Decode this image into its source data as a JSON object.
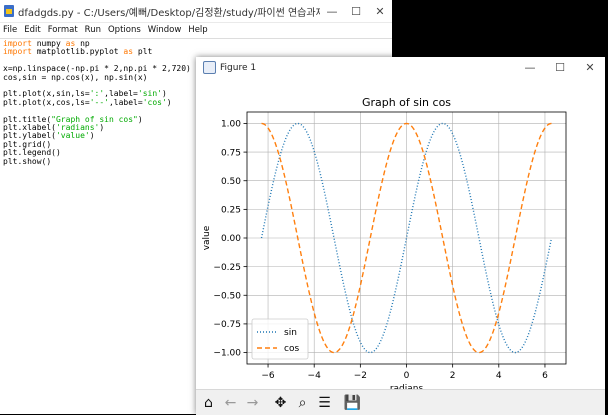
{
  "editor": {
    "title": "dfadgds.py - C:/Users/예뻐/Desktop/김정환/study/파이썬 연습과제/dfadgds.py ...",
    "menu": [
      "File",
      "Edit",
      "Format",
      "Run",
      "Options",
      "Window",
      "Help"
    ],
    "code": {
      "l1": {
        "kw1": "import",
        "mod1": " numpy ",
        "kw2": "as",
        "mod2": " np"
      },
      "l2": {
        "kw1": "import",
        "mod1": " matplotlib.pyplot ",
        "kw2": "as",
        "mod2": " plt"
      },
      "l4": "x=np.linspace(-np.pi * 2,np.pi * 2,720)",
      "l5": "cos,sin = np.cos(x), np.sin(x)",
      "l7": {
        "a": "plt.plot(x,sin,ls=",
        "s1": "':'",
        "b": ",label=",
        "s2": "'sin'",
        "c": ")"
      },
      "l8": {
        "a": "plt.plot(x,cos,ls=",
        "s1": "'--'",
        "b": ",label=",
        "s2": "'cos'",
        "c": ")"
      },
      "l10": {
        "a": "plt.title(",
        "s1": "\"Graph of sin cos\"",
        "c": ")"
      },
      "l11": {
        "a": "plt.xlabel(",
        "s1": "'radians'",
        "c": ")"
      },
      "l12": {
        "a": "plt.ylabel(",
        "s1": "'value'",
        "c": ")"
      },
      "l13": "plt.grid()",
      "l14": "plt.legend()",
      "l15": "plt.show()"
    }
  },
  "figure": {
    "title": "Figure 1",
    "window_controls": {
      "minimize": "—",
      "maximize": "☐",
      "close": "✕"
    },
    "toolbar": {
      "home": "⌂",
      "back": "←",
      "forward": "→",
      "pan": "✥",
      "zoom": "⌕",
      "configure": "☰",
      "save": "💾"
    }
  },
  "editor_controls": {
    "minimize": "—",
    "maximize": "☐",
    "close": "✕"
  },
  "chart_data": {
    "type": "line",
    "title": "Graph of sin cos",
    "xlabel": "radians",
    "ylabel": "value",
    "xlim": [
      -6.912,
      6.912
    ],
    "ylim": [
      -1.1,
      1.1
    ],
    "xticks": [
      -6,
      -4,
      -2,
      0,
      2,
      4,
      6
    ],
    "yticks": [
      -1.0,
      -0.75,
      -0.5,
      -0.25,
      0.0,
      0.25,
      0.5,
      0.75,
      1.0
    ],
    "xtick_labels": [
      "−6",
      "−4",
      "−2",
      "0",
      "2",
      "4",
      "6"
    ],
    "ytick_labels": [
      "−1.00",
      "−0.75",
      "−0.50",
      "−0.25",
      "0.00",
      "0.25",
      "0.50",
      "0.75",
      "1.00"
    ],
    "grid": true,
    "legend_position": "lower-left",
    "x_range": [
      -6.2832,
      6.2832
    ],
    "series": [
      {
        "name": "sin",
        "function": "sin",
        "linestyle": "dotted",
        "color": "#1f77b4"
      },
      {
        "name": "cos",
        "function": "cos",
        "linestyle": "dashed",
        "color": "#ff7f0e"
      }
    ]
  }
}
